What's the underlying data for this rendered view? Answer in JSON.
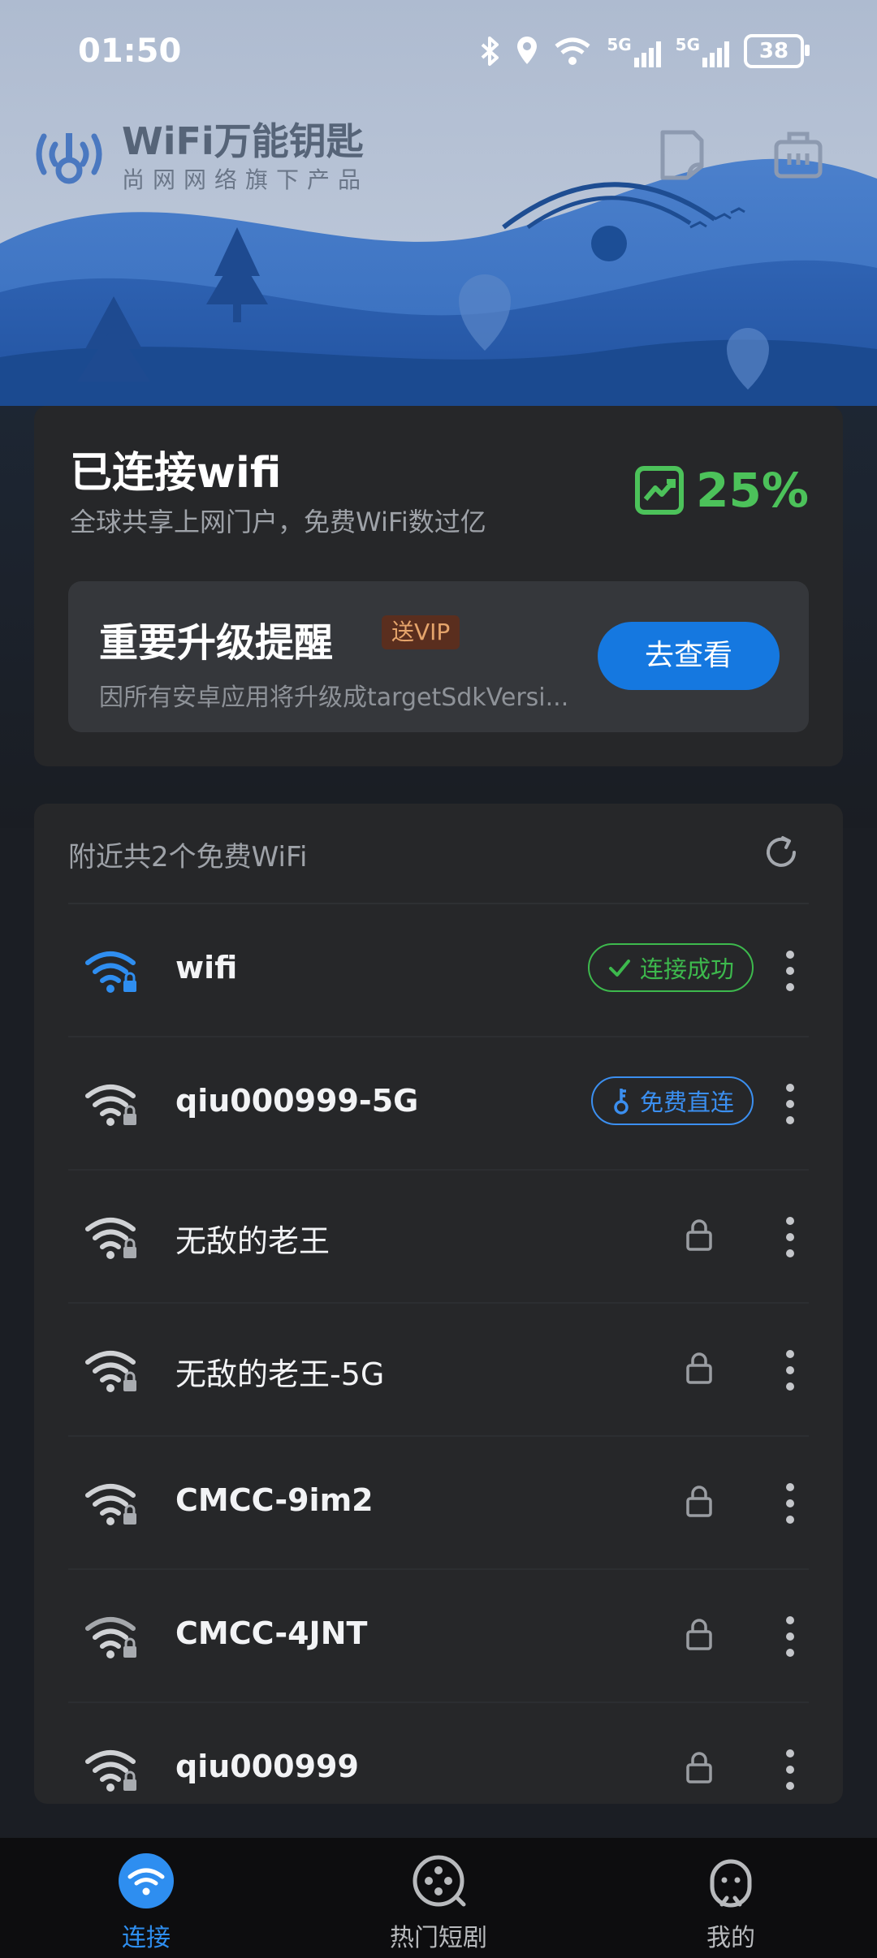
{
  "status_bar": {
    "time": "01:50",
    "battery": "38",
    "network_1": "5G",
    "network_2": "5G"
  },
  "header": {
    "logo_title": "WiFi万能钥匙",
    "logo_subtitle": "尚网网络旗下产品",
    "icons": [
      "document-icon",
      "briefcase-icon"
    ]
  },
  "connection_card": {
    "title": "已连接wifi",
    "subtitle": "全球共享上网门户，免费WiFi数过亿",
    "rate": "25%",
    "rate_icon": "trend-chart-icon",
    "accent_color": "#4cc25a"
  },
  "upgrade_banner": {
    "title": "重要升级提醒",
    "badge": "送VIP",
    "description": "因所有安卓应用将升级成targetSdkVersi...",
    "button_label": "去查看",
    "button_color": "#1578e0"
  },
  "wifi_list": {
    "header": "附近共2个免费WiFi",
    "networks": [
      {
        "name": "wifi",
        "status_label": "连接成功",
        "status_type": "connected",
        "signal_icon": "wifi-signal-connected-icon"
      },
      {
        "name": "qiu000999-5G",
        "status_label": "免费直连",
        "status_type": "free",
        "signal_icon": "wifi-signal-icon"
      },
      {
        "name": "无敌的老王",
        "status_label": "",
        "status_type": "locked",
        "signal_icon": "wifi-signal-icon"
      },
      {
        "name": "无敌的老王-5G",
        "status_label": "",
        "status_type": "locked",
        "signal_icon": "wifi-signal-icon"
      },
      {
        "name": "CMCC-9im2",
        "status_label": "",
        "status_type": "locked",
        "signal_icon": "wifi-signal-icon"
      },
      {
        "name": "CMCC-4JNT",
        "status_label": "",
        "status_type": "locked",
        "signal_icon": "wifi-signal-icon"
      },
      {
        "name": "qiu000999",
        "status_label": "",
        "status_type": "locked",
        "signal_icon": "wifi-signal-icon"
      }
    ]
  },
  "bottom_nav": {
    "items": [
      {
        "label": "连接",
        "icon": "wifi-icon",
        "active": true
      },
      {
        "label": "热门短剧",
        "icon": "film-reel-icon",
        "active": false
      },
      {
        "label": "我的",
        "icon": "profile-face-icon",
        "active": false
      }
    ],
    "active_color": "#2e8ef0"
  }
}
